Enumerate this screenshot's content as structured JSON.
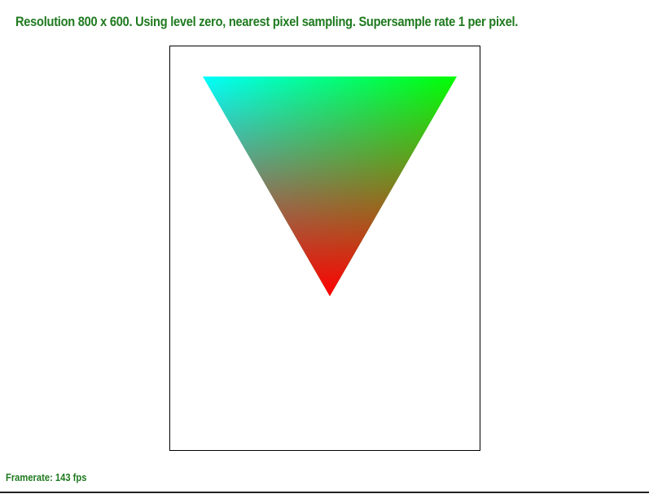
{
  "status": {
    "text": "Resolution 800 x 600. Using level zero, nearest pixel sampling. Supersample rate 1 per pixel."
  },
  "framerate": {
    "text": "Framerate: 143 fps"
  },
  "colors": {
    "text": "#1f7a1f",
    "vertex_top_left": "#00ffff",
    "vertex_top_right": "#00ff00",
    "vertex_bottom": "#ff0000",
    "border": "#000000"
  }
}
